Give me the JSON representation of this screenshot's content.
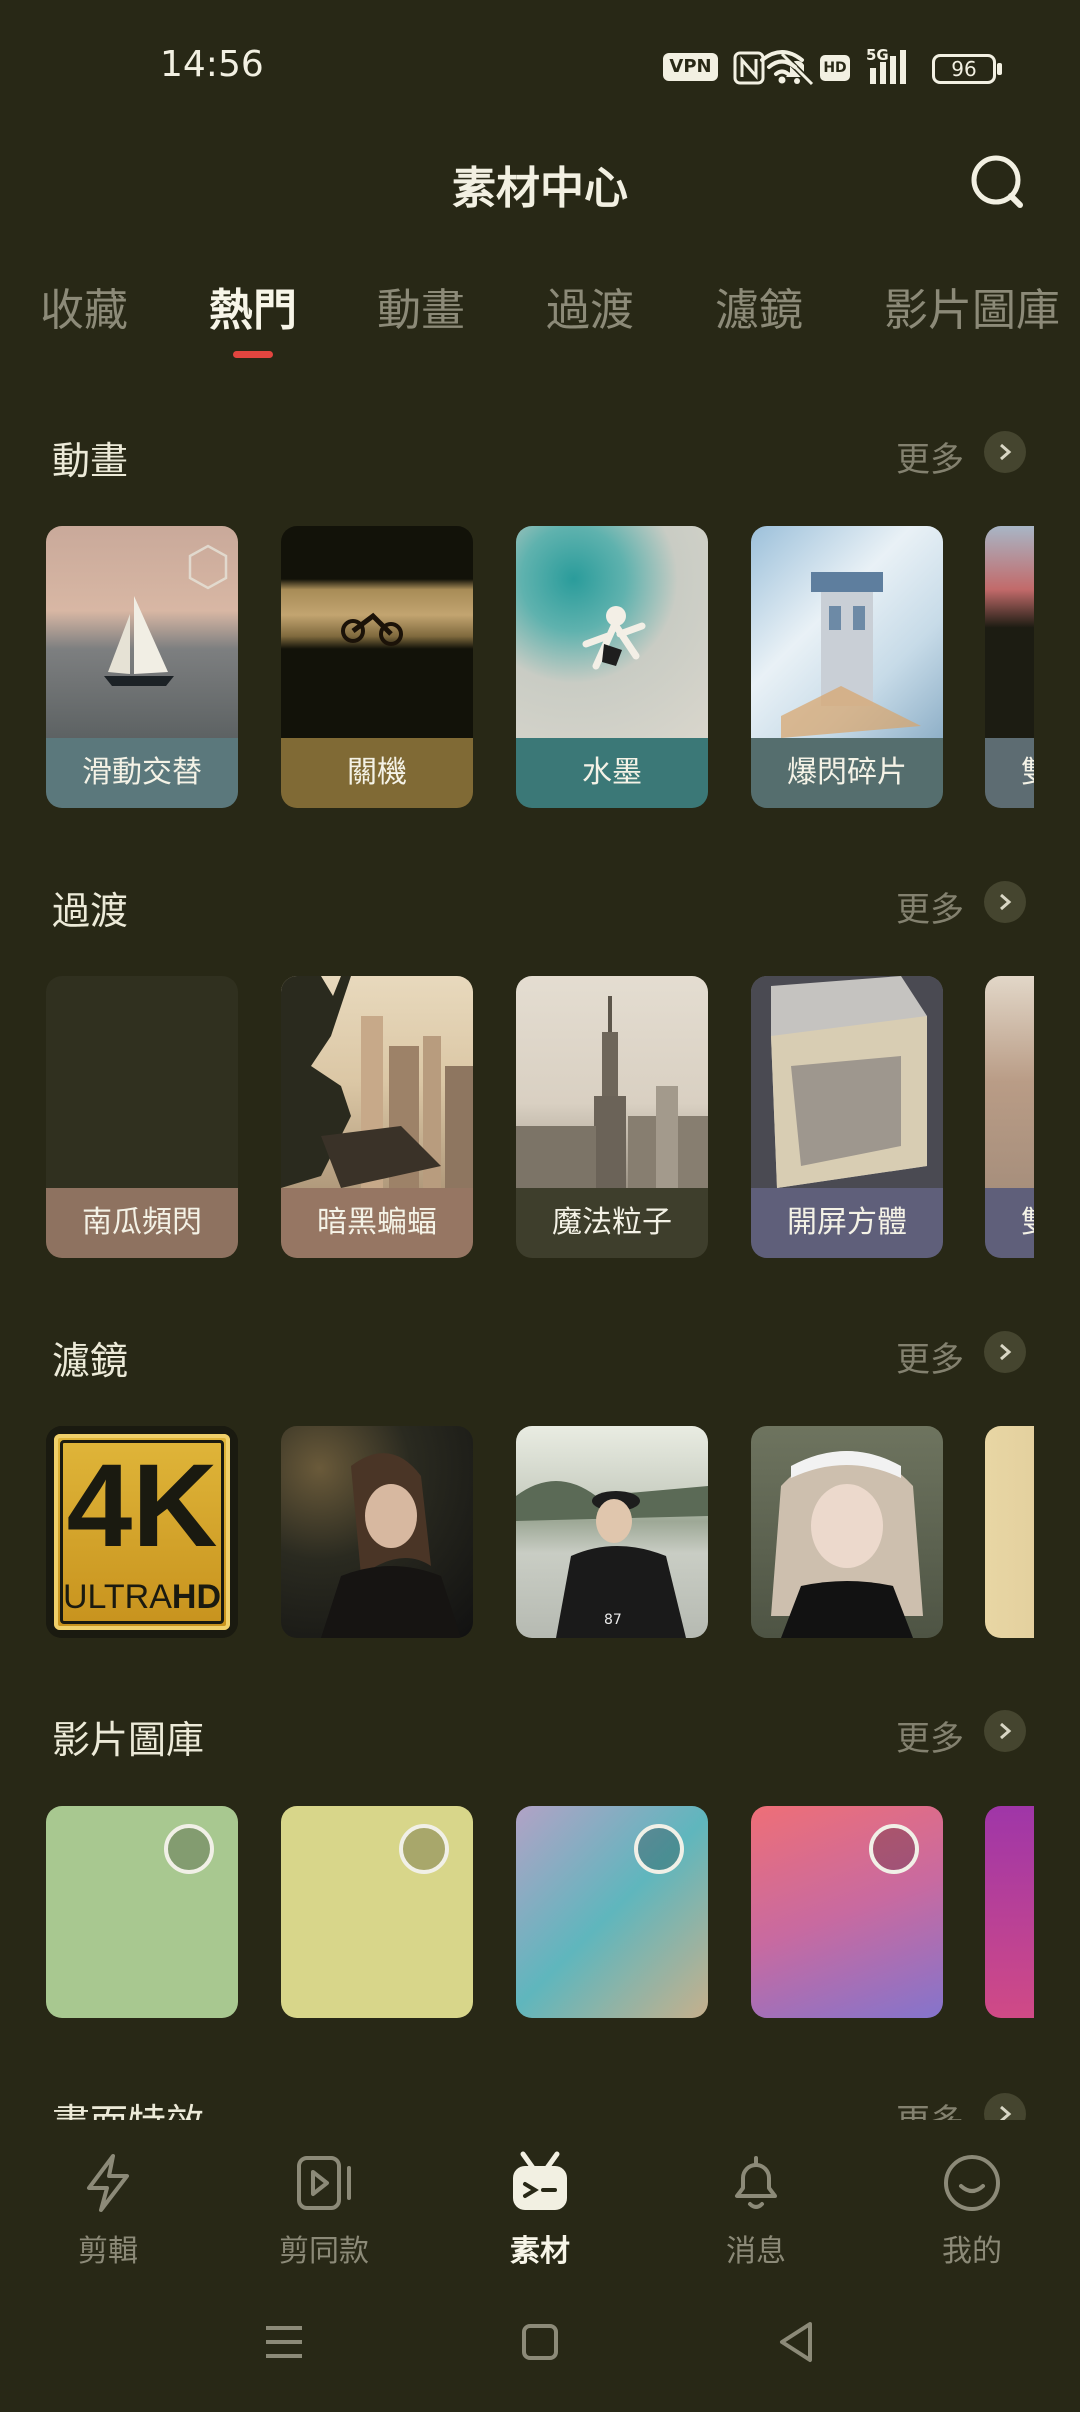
{
  "status_bar": {
    "time": "14:56",
    "vpn_label": "VPN",
    "hd_label": "HD",
    "network_label": "5G",
    "battery_level": "96",
    "icons": [
      "vpn-icon",
      "nfc-icon",
      "mute-bell-icon",
      "wifi-icon",
      "hd-icon",
      "signal-icon",
      "battery-icon"
    ]
  },
  "header": {
    "title": "素材中心",
    "search_icon": "search-icon"
  },
  "tabs": [
    {
      "label": "收藏",
      "active": false
    },
    {
      "label": "熱門",
      "active": true
    },
    {
      "label": "動畫",
      "active": false
    },
    {
      "label": "過渡",
      "active": false
    },
    {
      "label": "濾鏡",
      "active": false
    },
    {
      "label": "影片圖庫",
      "active": false
    }
  ],
  "sections": {
    "animation": {
      "title": "動畫",
      "more": "更多",
      "items": [
        {
          "label": "滑動交替",
          "color": "#5b787c"
        },
        {
          "label": "關機",
          "color": "#806a35"
        },
        {
          "label": "水墨",
          "color": "#3b7877"
        },
        {
          "label": "爆閃碎片",
          "color": "#556e6e"
        },
        {
          "label": "雙",
          "color": "#5d6c72"
        }
      ]
    },
    "transition": {
      "title": "過渡",
      "more": "更多",
      "items": [
        {
          "label": "南瓜頻閃",
          "color": "#8e7260"
        },
        {
          "label": "暗黑蝙蝠",
          "color": "#967663"
        },
        {
          "label": "魔法粒子",
          "color": "#3e3e2c"
        },
        {
          "label": "開屏方體",
          "color": "#5f5f7a"
        },
        {
          "label": "雙",
          "color": "#5f5f7a"
        }
      ]
    },
    "filter": {
      "title": "濾鏡",
      "more": "更多",
      "badge_4k": "4K",
      "badge_ultra": "ULTRA",
      "badge_hd": "HD",
      "jersey_number": "87"
    },
    "video_library": {
      "title": "影片圖庫",
      "more": "更多",
      "items": [
        {
          "gradient": [
            "#a8c890",
            "#a8c890"
          ]
        },
        {
          "gradient": [
            "#d8d68a",
            "#d8d68a"
          ]
        },
        {
          "gradient": [
            "#b2a2c6",
            "#5fb6bd",
            "#c6b08c"
          ]
        },
        {
          "gradient": [
            "#ee6f77",
            "#c86aa0",
            "#8474cc"
          ]
        },
        {
          "gradient": [
            "#9f36a8",
            "#d04a86"
          ]
        }
      ]
    },
    "screen_effects": {
      "title": "畫面特效",
      "more": "更多"
    }
  },
  "bottom_nav": [
    {
      "label": "剪輯",
      "icon": "lightning-icon",
      "active": false
    },
    {
      "label": "剪同款",
      "icon": "video-template-icon",
      "active": false
    },
    {
      "label": "素材",
      "icon": "material-icon",
      "active": true
    },
    {
      "label": "消息",
      "icon": "bell-icon",
      "active": false
    },
    {
      "label": "我的",
      "icon": "smiley-icon",
      "active": false
    }
  ],
  "system_nav": [
    "menu-icon",
    "home-icon",
    "back-icon"
  ]
}
